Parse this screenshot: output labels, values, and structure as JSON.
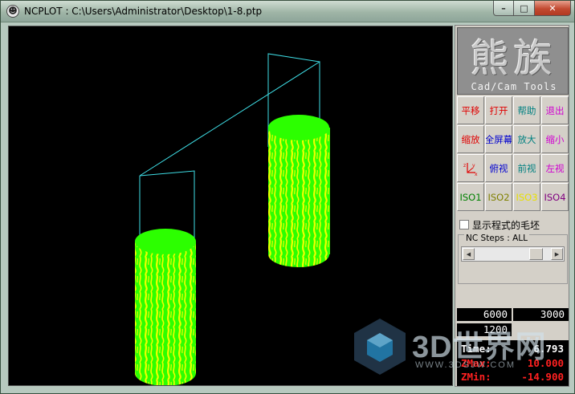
{
  "window": {
    "title": "NCPLOT : C:\\Users\\Administrator\\Desktop\\1-8.ptp",
    "min_glyph": "–",
    "max_glyph": "□",
    "close_glyph": "✕"
  },
  "logo": {
    "chars": "熊族",
    "subtitle": "Cad/Cam Tools"
  },
  "toolbar": [
    {
      "label": "平移",
      "color": "#e00000",
      "icon": ""
    },
    {
      "label": "打开",
      "color": "#e00000",
      "icon": ""
    },
    {
      "label": "帮助",
      "color": "#008080",
      "icon": ""
    },
    {
      "label": "退出",
      "color": "#d000d0",
      "icon": ""
    },
    {
      "label": "缩放",
      "color": "#e00000",
      "icon": ""
    },
    {
      "label": "全屏幕",
      "color": "#0000d0",
      "icon": ""
    },
    {
      "label": "放大",
      "color": "#008080",
      "icon": ""
    },
    {
      "label": "缩小",
      "color": "#d000d0",
      "icon": ""
    },
    {
      "label": "",
      "color": "#e00000",
      "icon": "axis-icon"
    },
    {
      "label": "俯视",
      "color": "#0000d0",
      "icon": ""
    },
    {
      "label": "前视",
      "color": "#008080",
      "icon": ""
    },
    {
      "label": "左视",
      "color": "#d000d0",
      "icon": ""
    },
    {
      "label": "ISO1",
      "color": "#008000",
      "icon": ""
    },
    {
      "label": "ISO2",
      "color": "#808000",
      "icon": ""
    },
    {
      "label": "ISO3",
      "color": "#e8e000",
      "icon": ""
    },
    {
      "label": "ISO4",
      "color": "#800080",
      "icon": ""
    }
  ],
  "stock_checkbox": {
    "label": "显示程式的毛坯",
    "checked": false
  },
  "nc_steps": {
    "label": "NC Steps : ALL",
    "position_fraction": 0.88
  },
  "readouts": {
    "a": "6000",
    "b": "3000",
    "c": "1200"
  },
  "info": {
    "time_label": "Time:",
    "time_value": "6.793",
    "zmax_label": "ZMax:",
    "zmax_value": "10.000",
    "zmin_label": "ZMin:",
    "zmin_value": "-14.900"
  },
  "colors": {
    "time": "#ffffff",
    "zmax": "#ff2020",
    "zmin": "#ff2020",
    "cylinder_green": "#2cff00",
    "cylinder_yellow": "#f0ff00",
    "toolpath": "#3fe0e8"
  },
  "watermark": {
    "text": "3D世界网",
    "sub": "WWW.3DSJW.COM"
  }
}
